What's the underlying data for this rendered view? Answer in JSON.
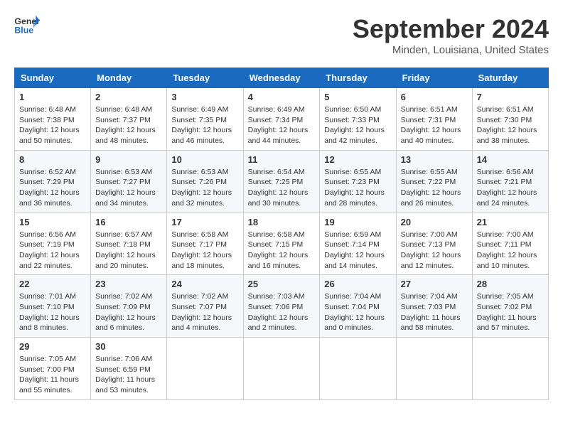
{
  "header": {
    "logo_line1": "General",
    "logo_line2": "Blue",
    "month": "September 2024",
    "location": "Minden, Louisiana, United States"
  },
  "weekdays": [
    "Sunday",
    "Monday",
    "Tuesday",
    "Wednesday",
    "Thursday",
    "Friday",
    "Saturday"
  ],
  "weeks": [
    [
      {
        "day": "1",
        "sunrise": "6:48 AM",
        "sunset": "7:38 PM",
        "daylight": "12 hours and 50 minutes."
      },
      {
        "day": "2",
        "sunrise": "6:48 AM",
        "sunset": "7:37 PM",
        "daylight": "12 hours and 48 minutes."
      },
      {
        "day": "3",
        "sunrise": "6:49 AM",
        "sunset": "7:35 PM",
        "daylight": "12 hours and 46 minutes."
      },
      {
        "day": "4",
        "sunrise": "6:49 AM",
        "sunset": "7:34 PM",
        "daylight": "12 hours and 44 minutes."
      },
      {
        "day": "5",
        "sunrise": "6:50 AM",
        "sunset": "7:33 PM",
        "daylight": "12 hours and 42 minutes."
      },
      {
        "day": "6",
        "sunrise": "6:51 AM",
        "sunset": "7:31 PM",
        "daylight": "12 hours and 40 minutes."
      },
      {
        "day": "7",
        "sunrise": "6:51 AM",
        "sunset": "7:30 PM",
        "daylight": "12 hours and 38 minutes."
      }
    ],
    [
      {
        "day": "8",
        "sunrise": "6:52 AM",
        "sunset": "7:29 PM",
        "daylight": "12 hours and 36 minutes."
      },
      {
        "day": "9",
        "sunrise": "6:53 AM",
        "sunset": "7:27 PM",
        "daylight": "12 hours and 34 minutes."
      },
      {
        "day": "10",
        "sunrise": "6:53 AM",
        "sunset": "7:26 PM",
        "daylight": "12 hours and 32 minutes."
      },
      {
        "day": "11",
        "sunrise": "6:54 AM",
        "sunset": "7:25 PM",
        "daylight": "12 hours and 30 minutes."
      },
      {
        "day": "12",
        "sunrise": "6:55 AM",
        "sunset": "7:23 PM",
        "daylight": "12 hours and 28 minutes."
      },
      {
        "day": "13",
        "sunrise": "6:55 AM",
        "sunset": "7:22 PM",
        "daylight": "12 hours and 26 minutes."
      },
      {
        "day": "14",
        "sunrise": "6:56 AM",
        "sunset": "7:21 PM",
        "daylight": "12 hours and 24 minutes."
      }
    ],
    [
      {
        "day": "15",
        "sunrise": "6:56 AM",
        "sunset": "7:19 PM",
        "daylight": "12 hours and 22 minutes."
      },
      {
        "day": "16",
        "sunrise": "6:57 AM",
        "sunset": "7:18 PM",
        "daylight": "12 hours and 20 minutes."
      },
      {
        "day": "17",
        "sunrise": "6:58 AM",
        "sunset": "7:17 PM",
        "daylight": "12 hours and 18 minutes."
      },
      {
        "day": "18",
        "sunrise": "6:58 AM",
        "sunset": "7:15 PM",
        "daylight": "12 hours and 16 minutes."
      },
      {
        "day": "19",
        "sunrise": "6:59 AM",
        "sunset": "7:14 PM",
        "daylight": "12 hours and 14 minutes."
      },
      {
        "day": "20",
        "sunrise": "7:00 AM",
        "sunset": "7:13 PM",
        "daylight": "12 hours and 12 minutes."
      },
      {
        "day": "21",
        "sunrise": "7:00 AM",
        "sunset": "7:11 PM",
        "daylight": "12 hours and 10 minutes."
      }
    ],
    [
      {
        "day": "22",
        "sunrise": "7:01 AM",
        "sunset": "7:10 PM",
        "daylight": "12 hours and 8 minutes."
      },
      {
        "day": "23",
        "sunrise": "7:02 AM",
        "sunset": "7:09 PM",
        "daylight": "12 hours and 6 minutes."
      },
      {
        "day": "24",
        "sunrise": "7:02 AM",
        "sunset": "7:07 PM",
        "daylight": "12 hours and 4 minutes."
      },
      {
        "day": "25",
        "sunrise": "7:03 AM",
        "sunset": "7:06 PM",
        "daylight": "12 hours and 2 minutes."
      },
      {
        "day": "26",
        "sunrise": "7:04 AM",
        "sunset": "7:04 PM",
        "daylight": "12 hours and 0 minutes."
      },
      {
        "day": "27",
        "sunrise": "7:04 AM",
        "sunset": "7:03 PM",
        "daylight": "11 hours and 58 minutes."
      },
      {
        "day": "28",
        "sunrise": "7:05 AM",
        "sunset": "7:02 PM",
        "daylight": "11 hours and 57 minutes."
      }
    ],
    [
      {
        "day": "29",
        "sunrise": "7:05 AM",
        "sunset": "7:00 PM",
        "daylight": "11 hours and 55 minutes."
      },
      {
        "day": "30",
        "sunrise": "7:06 AM",
        "sunset": "6:59 PM",
        "daylight": "11 hours and 53 minutes."
      },
      null,
      null,
      null,
      null,
      null
    ]
  ],
  "labels": {
    "sunrise": "Sunrise:",
    "sunset": "Sunset:",
    "daylight": "Daylight:"
  }
}
